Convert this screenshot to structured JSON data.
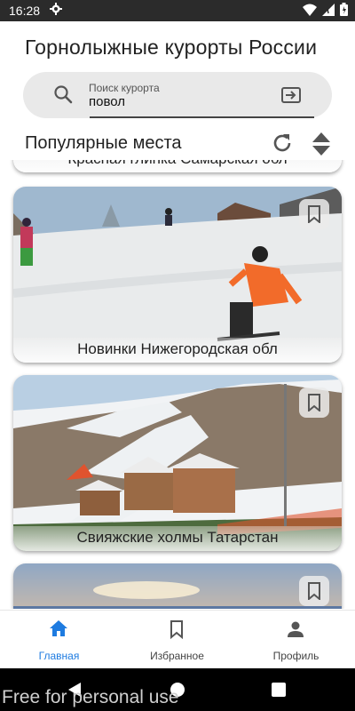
{
  "status": {
    "time": "16:28"
  },
  "title": "Горнолыжные курорты России",
  "search": {
    "label": "Поиск курорта",
    "value": "повол"
  },
  "section_title": "Популярные места",
  "cards": [
    {
      "caption": "Красная глинка  Самарская обл"
    },
    {
      "caption": "Новинки  Нижегородская обл"
    },
    {
      "caption": "Свияжские холмы  Татарстан"
    },
    {
      "caption": ""
    }
  ],
  "bottom_nav": [
    {
      "label": "Главная",
      "icon": "home-icon",
      "active": true
    },
    {
      "label": "Избранное",
      "icon": "bookmark-icon",
      "active": false
    },
    {
      "label": "Профиль",
      "icon": "person-icon",
      "active": false
    }
  ],
  "watermark": "Free for personal use",
  "colors": {
    "accent": "#1e7be0",
    "status_bar": "#2b2b2b"
  }
}
